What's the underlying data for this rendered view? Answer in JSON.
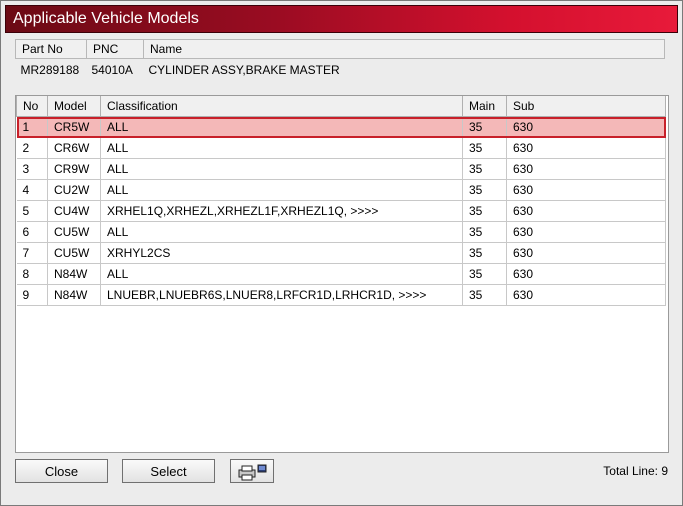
{
  "window": {
    "title": "Applicable Vehicle Models"
  },
  "part_info": {
    "headers": [
      "Part No",
      "PNC",
      "Name"
    ],
    "part_no": "MR289188",
    "pnc": "54010A",
    "name": "CYLINDER ASSY,BRAKE MASTER"
  },
  "list": {
    "headers": [
      "No",
      "Model",
      "Classification",
      "Main",
      "Sub"
    ],
    "selected_index": 0,
    "rows": [
      {
        "no": "1",
        "model": "CR5W",
        "classification": "ALL",
        "main": "35",
        "sub": "630"
      },
      {
        "no": "2",
        "model": "CR6W",
        "classification": "ALL",
        "main": "35",
        "sub": "630"
      },
      {
        "no": "3",
        "model": "CR9W",
        "classification": "ALL",
        "main": "35",
        "sub": "630"
      },
      {
        "no": "4",
        "model": "CU2W",
        "classification": "ALL",
        "main": "35",
        "sub": "630"
      },
      {
        "no": "5",
        "model": "CU4W",
        "classification": "XRHEL1Q,XRHEZL,XRHEZL1F,XRHEZL1Q,  >>>>",
        "main": "35",
        "sub": "630"
      },
      {
        "no": "6",
        "model": "CU5W",
        "classification": "ALL",
        "main": "35",
        "sub": "630"
      },
      {
        "no": "7",
        "model": "CU5W",
        "classification": "XRHYL2CS",
        "main": "35",
        "sub": "630"
      },
      {
        "no": "8",
        "model": "N84W",
        "classification": "ALL",
        "main": "35",
        "sub": "630"
      },
      {
        "no": "9",
        "model": "N84W",
        "classification": "LNUEBR,LNUEBR6S,LNUER8,LRFCR1D,LRHCR1D,  >>>>",
        "main": "35",
        "sub": "630"
      }
    ]
  },
  "buttons": {
    "close": "Close",
    "select": "Select",
    "print_icon": "printer-icon"
  },
  "status": {
    "total_line": "Total Line: 9"
  }
}
